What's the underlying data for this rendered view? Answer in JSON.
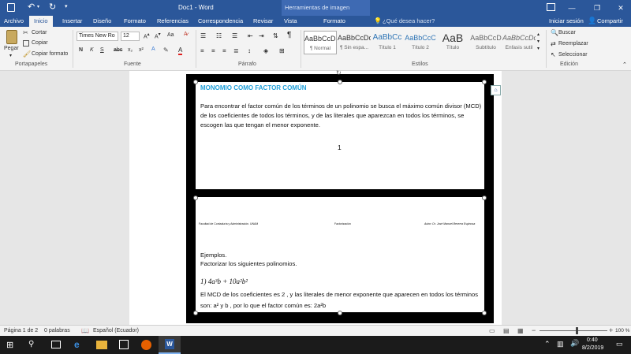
{
  "titlebar": {
    "doc_title": "Doc1 - Word",
    "tools_context": "Herramientas de imagen",
    "minimize": "—",
    "restore": "❐",
    "close": "✕"
  },
  "tabs": {
    "archivo": "Archivo",
    "inicio": "Inicio",
    "insertar": "Insertar",
    "diseno": "Diseño",
    "formato1": "Formato",
    "referencias": "Referencias",
    "correspondencia": "Correspondencia",
    "revisar": "Revisar",
    "vista": "Vista",
    "formato2": "Formato",
    "tellme": "¿Qué desea hacer?",
    "signin": "Iniciar sesión",
    "share": "Compartir"
  },
  "ribbon": {
    "clipboard": {
      "paste": "Pegar",
      "cut": "Cortar",
      "copy": "Copiar",
      "format_painter": "Copiar formato",
      "label": "Portapapeles"
    },
    "font": {
      "font_name": "Times New Ro",
      "font_size": "12",
      "bold": "N",
      "italic": "K",
      "underline": "S",
      "strike": "abc",
      "sub": "x₂",
      "sup": "x²",
      "label": "Fuente"
    },
    "paragraph": {
      "label": "Párrafo",
      "pilcrow": "¶"
    },
    "styles": {
      "label": "Estilos",
      "items": [
        {
          "sample": "AaBbCcDc",
          "name": "¶ Normal"
        },
        {
          "sample": "AaBbCcDc",
          "name": "¶ Sin espa..."
        },
        {
          "sample": "AaBbCc",
          "name": "Título 1"
        },
        {
          "sample": "AaBbCcC",
          "name": "Título 2"
        },
        {
          "sample": "AaB",
          "name": "Título"
        },
        {
          "sample": "AaBbCcD",
          "name": "Subtítulo"
        },
        {
          "sample": "AaBbCcDc",
          "name": "Énfasis sutil"
        }
      ]
    },
    "editing": {
      "find": "Buscar",
      "replace": "Reemplazar",
      "select": "Seleccionar",
      "label": "Edición"
    }
  },
  "document": {
    "heading": "MONOMIO COMO FACTOR COMÚN",
    "para1_line1": "Para encontrar el factor común de los términos de un polinomio se busca el máximo común divisor (MCD)",
    "para1_line2": "de los coeficientes de todos los términos, y de las literales que aparezcan en todos los términos, se",
    "para1_line3": "escogen las que tengan el menor exponente.",
    "page_number": "1",
    "footer_left": "Facultad de Contaduría y Administración. UNAM",
    "footer_center": "Factorización",
    "footer_right": "Autor: Dr. José Manuel Becerra Espinosa",
    "ejemplos": "Ejemplos.",
    "factorizar": "Factorizar los siguientes polinomios.",
    "item1": "1)  4a³b + 10a²b²",
    "mcd_line1": "El MCD de los coeficientes es  2 , y las literales de menor exponente que aparecen en todos los términos",
    "mcd_line2": "son:  a²  y  b , por lo que el factor común es:  2a²b"
  },
  "statusbar": {
    "page": "Página 1 de 2",
    "words": "0 palabras",
    "language": "Español (Ecuador)",
    "zoom": "100 %"
  },
  "taskbar": {
    "time": "0:40",
    "date": "8/2/2019"
  },
  "colors": {
    "word_blue": "#2b579a",
    "heading_blue": "#1f9fd9"
  }
}
